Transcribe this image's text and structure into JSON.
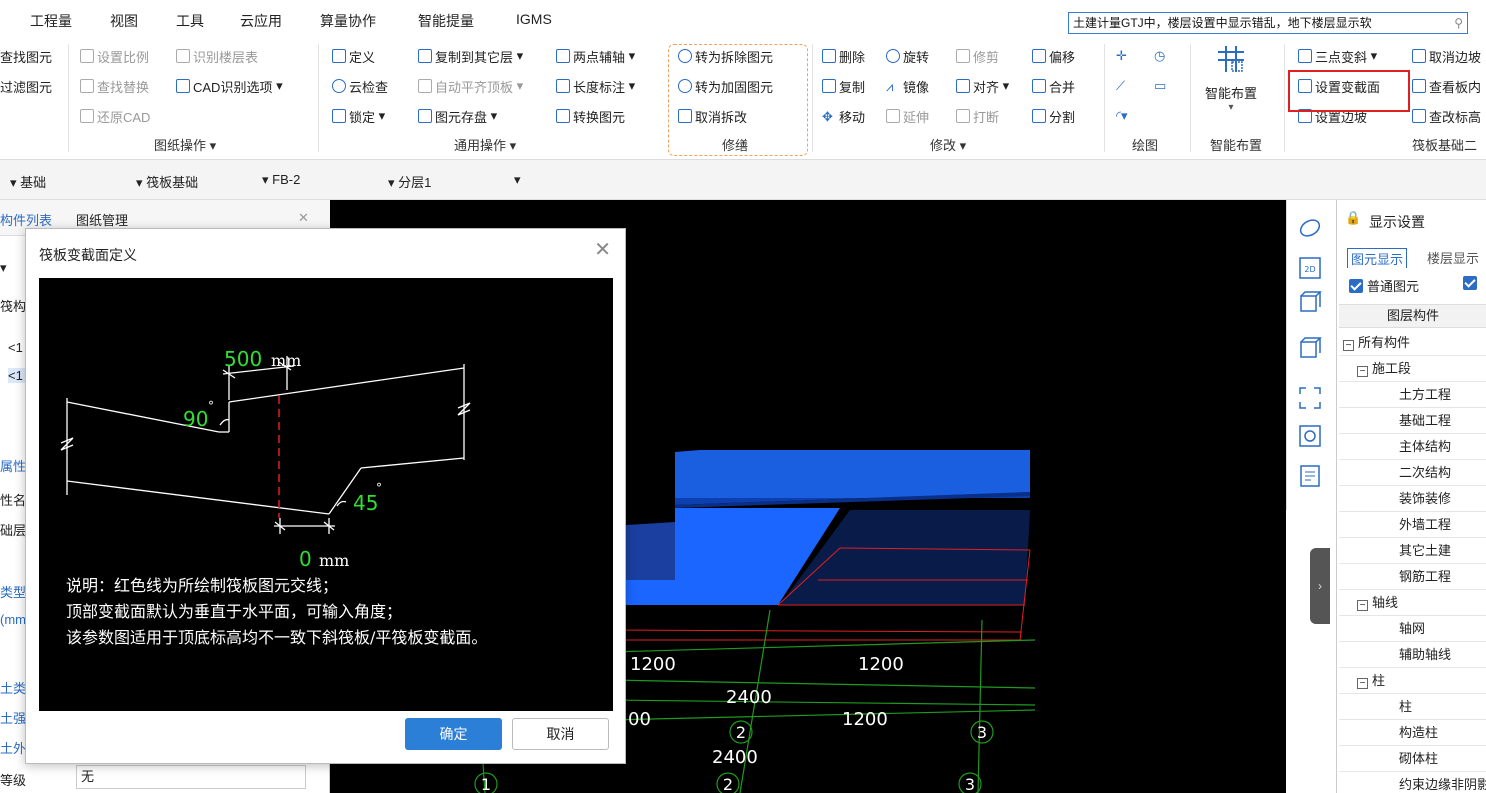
{
  "menu": [
    "工程量",
    "视图",
    "工具",
    "云应用",
    "算量协作",
    "智能提量",
    "IGMS"
  ],
  "search": {
    "value": "土建计量GTJ中，楼层设置中显示错乱，地下楼层显示软"
  },
  "ribbon": {
    "drawing_ops": {
      "left_col": [
        "查找图元",
        "过滤图元"
      ],
      "col2": [
        "设置比例",
        "查找替换",
        "还原CAD"
      ],
      "col3": [
        "识别楼层表",
        "CAD识别选项"
      ],
      "label": "图纸操作"
    },
    "general_ops": {
      "col1": [
        "定义",
        "云检查",
        "锁定"
      ],
      "col2": [
        "复制到其它层",
        "自动平齐顶板",
        "图元存盘"
      ],
      "col3": [
        "两点辅轴",
        "长度标注",
        "转换图元"
      ],
      "label": "通用操作"
    },
    "repair": {
      "items": [
        "转为拆除图元",
        "转为加固图元",
        "取消拆改"
      ],
      "label": "修缮"
    },
    "modify": {
      "col1": [
        "删除",
        "复制",
        "移动"
      ],
      "col2": [
        "旋转",
        "镜像",
        "延伸"
      ],
      "col3": [
        "修剪",
        "对齐",
        "打断"
      ],
      "col4": [
        "偏移",
        "合并",
        "分割"
      ],
      "label": "修改"
    },
    "draw": {
      "label": "绘图"
    },
    "smart": {
      "button": "智能布置",
      "label": "智能布置"
    },
    "raft": {
      "col1": [
        "三点变斜",
        "设置变截面",
        "设置边坡"
      ],
      "col2": [
        "取消边坡",
        "查看板内",
        "查改标高"
      ],
      "label": "筏板基础二"
    }
  },
  "bar2": [
    "基础",
    "筏板基础",
    "FB-2",
    "分层1"
  ],
  "leftpanel": {
    "tabs": [
      "构件列表",
      "图纸管理"
    ],
    "frags": [
      "筏构件",
      "<1",
      "<1",
      "属性",
      "性名",
      "础层",
      "类型",
      "(mm",
      "土类",
      "土强",
      "土外"
    ],
    "grade_label": "等级",
    "grade_value": "无"
  },
  "dialog": {
    "title": "筏板变截面定义",
    "dims": {
      "top_width": "500",
      "top_unit": "mm",
      "top_angle": "90",
      "bottom_angle": "45",
      "bottom_width": "0",
      "bottom_unit": "mm",
      "deg": "°"
    },
    "notes": [
      "说明：红色线为所绘制筏板图元交线；",
      "顶部变截面默认为垂直于水平面，可输入角度；",
      "该参数图适用于顶底标高均不一致下斜筏板/平筏板变截面。"
    ],
    "ok": "确定",
    "cancel": "取消"
  },
  "canvas": {
    "dims": [
      "1200",
      "1200",
      "2400",
      "00",
      "1200",
      "2400"
    ],
    "axis_labels": [
      "2",
      "3",
      "1",
      "2",
      "3"
    ]
  },
  "rightpanel": {
    "title": "显示设置",
    "tabs": [
      "图元显示",
      "楼层显示"
    ],
    "checks": [
      "普通图元"
    ],
    "column_header": "图层构件",
    "tree": [
      {
        "label": "所有构件",
        "level": 0,
        "box": "−"
      },
      {
        "label": "施工段",
        "level": 1,
        "box": "−"
      },
      {
        "label": "土方工程",
        "level": 2
      },
      {
        "label": "基础工程",
        "level": 2
      },
      {
        "label": "主体结构",
        "level": 2
      },
      {
        "label": "二次结构",
        "level": 2
      },
      {
        "label": "装饰装修",
        "level": 2
      },
      {
        "label": "外墙工程",
        "level": 2
      },
      {
        "label": "其它土建",
        "level": 2
      },
      {
        "label": "钢筋工程",
        "level": 2
      },
      {
        "label": "轴线",
        "level": 1,
        "box": "−"
      },
      {
        "label": "轴网",
        "level": 2
      },
      {
        "label": "辅助轴线",
        "level": 2
      },
      {
        "label": "柱",
        "level": 1,
        "box": "−"
      },
      {
        "label": "柱",
        "level": 2
      },
      {
        "label": "构造柱",
        "level": 2
      },
      {
        "label": "砌体柱",
        "level": 2
      },
      {
        "label": "约束边缘非阴影",
        "level": 2
      }
    ]
  },
  "colors": {
    "accent": "#2b7fd6",
    "highlight": "#e02020",
    "repair_border": "#f0a060",
    "slab_blue": "#1a66ff",
    "grid_green": "#1f9a1f"
  }
}
